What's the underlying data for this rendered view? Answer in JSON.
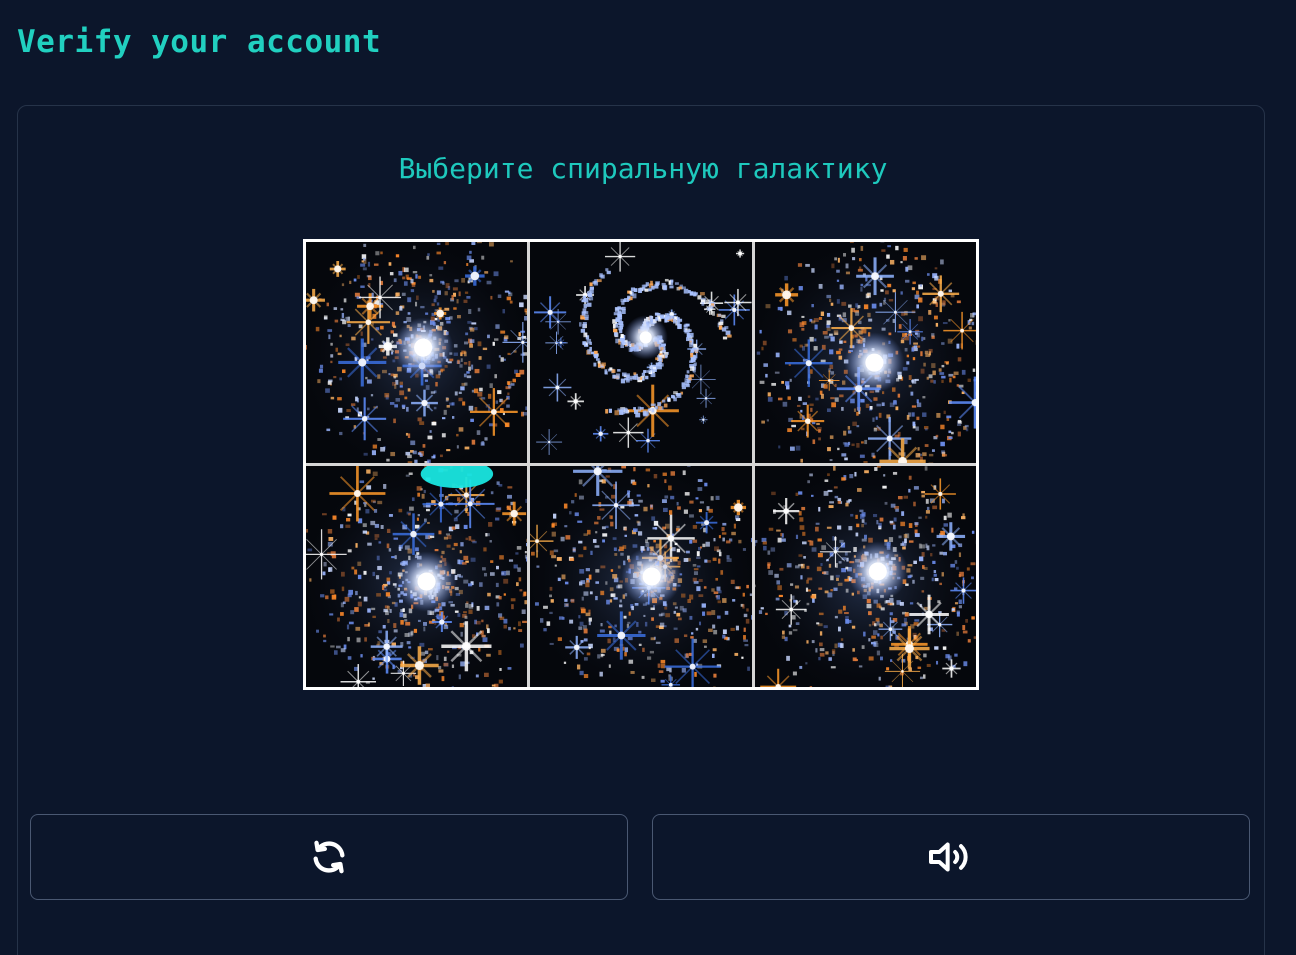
{
  "page": {
    "title": "Verify your account"
  },
  "captcha": {
    "prompt": "Выберите спиральную галактику",
    "tiles": [
      {
        "index": 1,
        "content": "galaxy-cluster-image"
      },
      {
        "index": 2,
        "content": "spiral-galaxy-image"
      },
      {
        "index": 3,
        "content": "galaxy-cluster-image"
      },
      {
        "index": 4,
        "content": "galaxy-cluster-image"
      },
      {
        "index": 5,
        "content": "galaxy-cluster-image"
      },
      {
        "index": 6,
        "content": "galaxy-cluster-image"
      }
    ]
  },
  "controls": {
    "refresh_icon": "refresh-icon",
    "audio_icon": "speaker-icon"
  },
  "colors": {
    "background": "#0c162b",
    "accent": "#21d0c0",
    "arrow": "#ff2020",
    "card_border": "#263349",
    "button_border": "#4a5872"
  }
}
